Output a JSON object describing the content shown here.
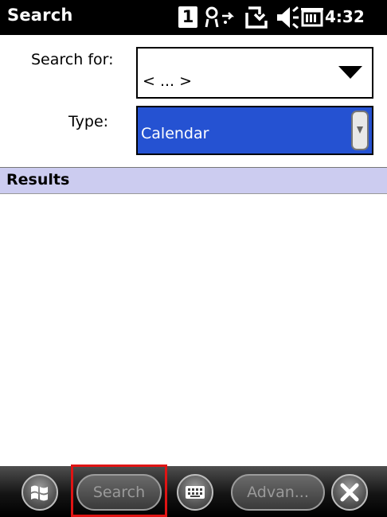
{
  "titlebar": {
    "title": "Search",
    "notification_count": "1",
    "clock": "4:32",
    "icons": [
      "connectivity-icon",
      "sync-icon",
      "volume-icon",
      "battery-icon"
    ]
  },
  "form": {
    "search_for_label": "Search for:",
    "search_for_value": "< ... >",
    "type_label": "Type:",
    "type_value": "Calendar"
  },
  "results": {
    "header": "Results",
    "items": []
  },
  "menubar": {
    "search_button": "Search",
    "advanced_button": "Advan..."
  },
  "colors": {
    "titlebar_bg": "#000000",
    "selection_bg": "#2552d2",
    "results_header_bg": "#ccccf0",
    "highlight": "#e01414"
  }
}
